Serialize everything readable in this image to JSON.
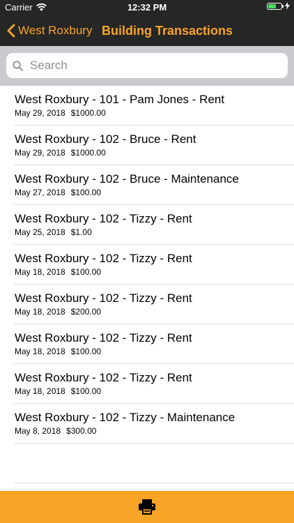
{
  "status_bar": {
    "carrier": "Carrier",
    "time": "12:32 PM"
  },
  "nav": {
    "back_label": "West Roxbury",
    "title": "Building Transactions"
  },
  "search": {
    "placeholder": "Search",
    "value": ""
  },
  "transactions": [
    {
      "title": "West Roxbury - 101 - Pam Jones - Rent",
      "date": "May 29, 2018",
      "amount": "$1000.00"
    },
    {
      "title": "West Roxbury - 102 - Bruce - Rent",
      "date": "May 29, 2018",
      "amount": "$1000.00"
    },
    {
      "title": "West Roxbury - 102 - Bruce - Maintenance",
      "date": "May 27, 2018",
      "amount": "$100.00"
    },
    {
      "title": "West Roxbury - 102 - Tizzy - Rent",
      "date": "May 25, 2018",
      "amount": "$1.00"
    },
    {
      "title": "West Roxbury - 102 - Tizzy - Rent",
      "date": "May 18, 2018",
      "amount": "$100.00"
    },
    {
      "title": "West Roxbury - 102 - Tizzy - Rent",
      "date": "May 18, 2018",
      "amount": "$200.00"
    },
    {
      "title": "West Roxbury - 102 - Tizzy - Rent",
      "date": "May 18, 2018",
      "amount": "$100.00"
    },
    {
      "title": "West Roxbury - 102 - Tizzy - Rent",
      "date": "May 18, 2018",
      "amount": "$100.00"
    },
    {
      "title": "West Roxbury - 102 - Tizzy - Maintenance",
      "date": "May 8, 2018",
      "amount": "$300.00"
    }
  ],
  "toolbar": {
    "print_icon": "printer-icon"
  },
  "colors": {
    "accent": "#f8a427",
    "bar": "#262626",
    "search_bg": "#c9c9ce"
  }
}
